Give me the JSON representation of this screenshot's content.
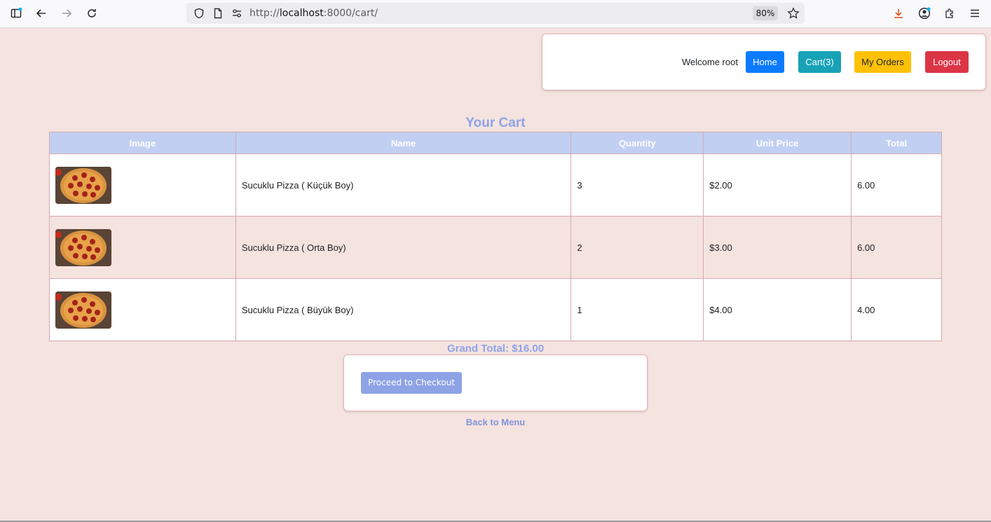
{
  "browser": {
    "url_prefix": "http://",
    "url_host": "localhost",
    "url_rest": ":8000/cart/",
    "zoom": "80%"
  },
  "nav": {
    "welcome": "Welcome root",
    "home": "Home",
    "cart": "Cart(3)",
    "orders": "My Orders",
    "logout": "Logout"
  },
  "page": {
    "title": "Your Cart",
    "grand_total": "Grand Total: $16.00",
    "checkout": "Proceed to Checkout",
    "back": "Back to Menu"
  },
  "table": {
    "headers": [
      "Image",
      "Name",
      "Quantity",
      "Unit Price",
      "Total"
    ],
    "rows": [
      {
        "name": "Sucuklu Pizza ( Küçük Boy)",
        "quantity": "3",
        "unit_price": "$2.00",
        "total": "6.00"
      },
      {
        "name": "Sucuklu Pizza ( Orta Boy)",
        "quantity": "2",
        "unit_price": "$3.00",
        "total": "6.00"
      },
      {
        "name": "Sucuklu Pizza ( Büyük Boy)",
        "quantity": "1",
        "unit_price": "$4.00",
        "total": "4.00"
      }
    ]
  },
  "colors": {
    "accent": "#8ea3e6",
    "home": "#0a7bff",
    "cart": "#17a2b8",
    "orders": "#ffc107",
    "logout": "#dc3545"
  }
}
